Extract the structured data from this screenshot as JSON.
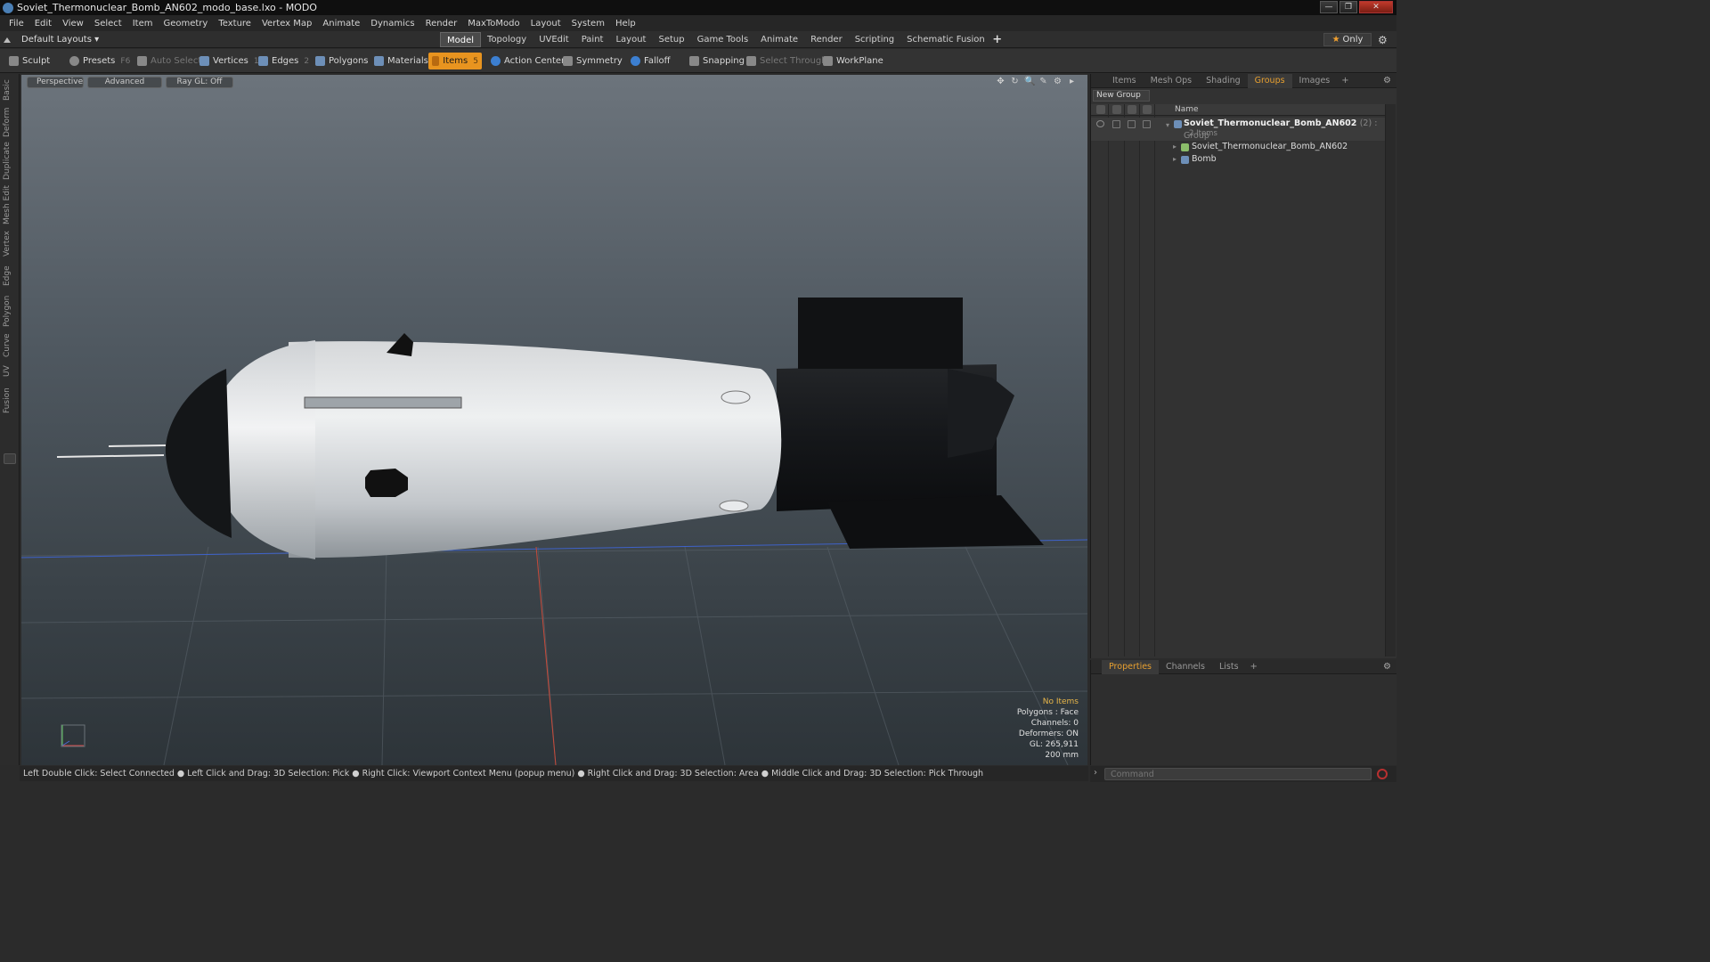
{
  "window": {
    "title": "Soviet_Thermonuclear_Bomb_AN602_modo_base.lxo - MODO",
    "minimize": "—",
    "maximize": "❐",
    "close": "✕"
  },
  "menu": [
    "File",
    "Edit",
    "View",
    "Select",
    "Item",
    "Geometry",
    "Texture",
    "Vertex Map",
    "Animate",
    "Dynamics",
    "Render",
    "MaxToModo",
    "Layout",
    "System",
    "Help"
  ],
  "layouts": {
    "label": "Default Layouts ▾",
    "tabs": [
      "Model",
      "Topology",
      "UVEdit",
      "Paint",
      "Layout",
      "Setup",
      "Game Tools",
      "Animate",
      "Render",
      "Scripting",
      "Schematic Fusion"
    ],
    "active_tab": "Model",
    "add": "+",
    "only_label": "Only",
    "star": "★",
    "gear": "⚙"
  },
  "toolbar": {
    "sculpt": "Sculpt",
    "presets": "Presets",
    "presets_key": "F6",
    "auto_select": "Auto Select",
    "vertices": "Vertices",
    "vertices_key": "1",
    "edges": "Edges",
    "edges_key": "2",
    "polygons": "Polygons",
    "materials": "Materials",
    "items": "Items",
    "items_key": "5",
    "action_center": "Action Center",
    "symmetry": "Symmetry",
    "falloff": "Falloff",
    "snapping": "Snapping",
    "select_through": "Select Through",
    "workplane": "WorkPlane"
  },
  "left_tabs": [
    "Basic",
    "Deform",
    "Duplicate",
    "Mesh Edit",
    "Vertex",
    "Edge",
    "Polygon",
    "Curve",
    "UV",
    "Fusion"
  ],
  "viewport": {
    "view": "Perspective",
    "mode": "Advanced",
    "raygl": "Ray GL: Off",
    "icons": [
      "✥",
      "↻",
      "🔍",
      "✎",
      "⚙",
      "▸"
    ],
    "info": {
      "no_items": "No Items",
      "polygons": "Polygons : Face",
      "channels": "Channels: 0",
      "deformers": "Deformers: ON",
      "gl": "GL: 265,911",
      "scale": "200 mm"
    }
  },
  "status_bar": "Left Double Click: Select Connected ● Left Click and Drag: 3D Selection: Pick ● Right Click: Viewport Context Menu (popup menu) ● Right Click and Drag: 3D Selection: Area ● Middle Click and Drag: 3D Selection: Pick Through",
  "right_panel": {
    "tabs": [
      "Items",
      "Mesh Ops",
      "Shading",
      "Groups",
      "Images"
    ],
    "active_tab": "Groups",
    "add": "+",
    "new_group": "New Group",
    "column_name": "Name",
    "group": {
      "name": "Soviet_Thermonuclear_Bomb_AN602",
      "count": "(2) : Group",
      "subtitle": "2 Items"
    },
    "items": [
      "Soviet_Thermonuclear_Bomb_AN602",
      "Bomb"
    ]
  },
  "bottom_panel": {
    "tabs": [
      "Properties",
      "Channels",
      "Lists"
    ],
    "active_tab": "Properties",
    "add": "+"
  },
  "command": {
    "placeholder": "Command",
    "arrow": "›"
  },
  "colors": {
    "accent": "#e8941f",
    "active_tab_text": "#e8a030",
    "info_highlight": "#e8b64a"
  }
}
